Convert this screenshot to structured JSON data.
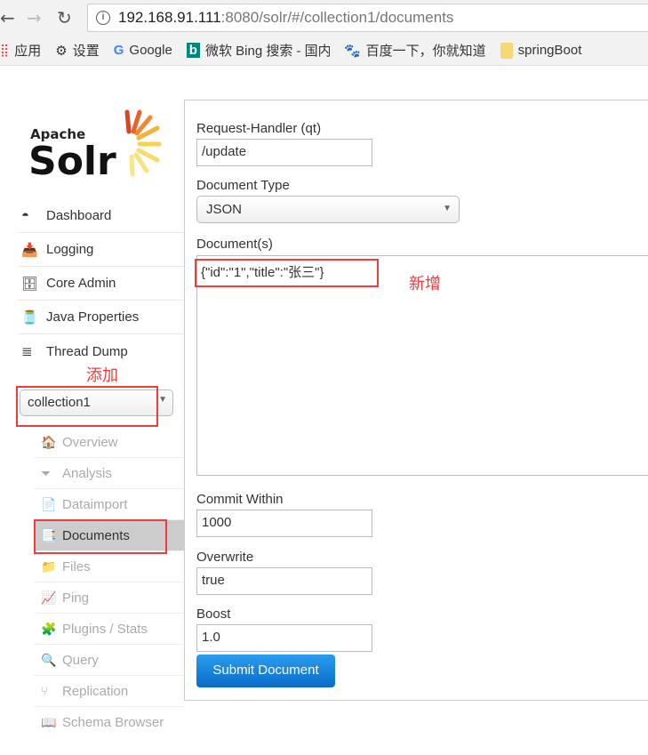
{
  "browser": {
    "url_host": "192.168.91.111",
    "url_rest": ":8080/solr/#/collection1/documents",
    "bookmarks": [
      {
        "label": "应用",
        "icon": "apps-icon"
      },
      {
        "label": "设置",
        "icon": "gear-icon"
      },
      {
        "label": "Google",
        "icon": "google-icon"
      },
      {
        "label": "微软 Bing 搜索 - 国内",
        "icon": "bing-icon"
      },
      {
        "label": "百度一下，你就知道",
        "icon": "baidu-icon"
      },
      {
        "label": "springBoot",
        "icon": "folder-icon"
      }
    ]
  },
  "logo": {
    "apache": "Apache",
    "solr": "Solr"
  },
  "sidebar": {
    "items": [
      {
        "label": "Dashboard"
      },
      {
        "label": "Logging"
      },
      {
        "label": "Core Admin"
      },
      {
        "label": "Java Properties"
      },
      {
        "label": "Thread Dump"
      }
    ],
    "core_select": "collection1",
    "core_items": [
      {
        "label": "Overview"
      },
      {
        "label": "Analysis"
      },
      {
        "label": "Dataimport"
      },
      {
        "label": "Documents"
      },
      {
        "label": "Files"
      },
      {
        "label": "Ping"
      },
      {
        "label": "Plugins / Stats"
      },
      {
        "label": "Query"
      },
      {
        "label": "Replication"
      },
      {
        "label": "Schema Browser"
      }
    ]
  },
  "form": {
    "handler_label": "Request-Handler (qt)",
    "handler_value": "/update",
    "type_label": "Document Type",
    "type_value": "JSON",
    "docs_label": "Document(s)",
    "docs_value": "{\"id\":\"1\",\"title\":\"张三\"}",
    "commit_label": "Commit Within",
    "commit_value": "1000",
    "overwrite_label": "Overwrite",
    "overwrite_value": "true",
    "boost_label": "Boost",
    "boost_value": "1.0",
    "submit": "Submit Document"
  },
  "annotations": {
    "add": "添加",
    "new": "新增"
  },
  "colors": {
    "annotation": "#f03c3c",
    "submit": "#1e88e5"
  }
}
